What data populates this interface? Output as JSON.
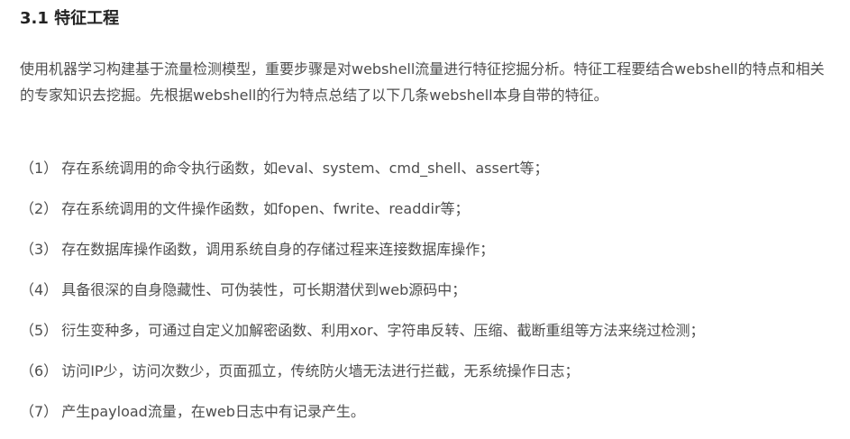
{
  "section": {
    "title": "3.1 特征工程"
  },
  "intro": {
    "text": "使用机器学习构建基于流量检测模型，重要步骤是对webshell流量进行特征挖掘分析。特征工程要结合webshell的特点和相关的专家知识去挖掘。先根据webshell的行为特点总结了以下几条webshell本身自带的特征。"
  },
  "features": [
    {
      "num": "（1）",
      "text": "存在系统调用的命令执行函数，如eval、system、cmd_shell、assert等；"
    },
    {
      "num": "（2）",
      "text": "存在系统调用的文件操作函数，如fopen、fwrite、readdir等；"
    },
    {
      "num": "（3）",
      "text": "存在数据库操作函数，调用系统自身的存储过程来连接数据库操作；"
    },
    {
      "num": "（4）",
      "text": "具备很深的自身隐藏性、可伪装性，可长期潜伏到web源码中；"
    },
    {
      "num": "（5）",
      "text": "衍生变种多，可通过自定义加解密函数、利用xor、字符串反转、压缩、截断重组等方法来绕过检测；"
    },
    {
      "num": "（6）",
      "text": "访问IP少，访问次数少，页面孤立，传统防火墙无法进行拦截，无系统操作日志；"
    },
    {
      "num": "（7）",
      "text": "产生payload流量，在web日志中有记录产生。"
    }
  ]
}
